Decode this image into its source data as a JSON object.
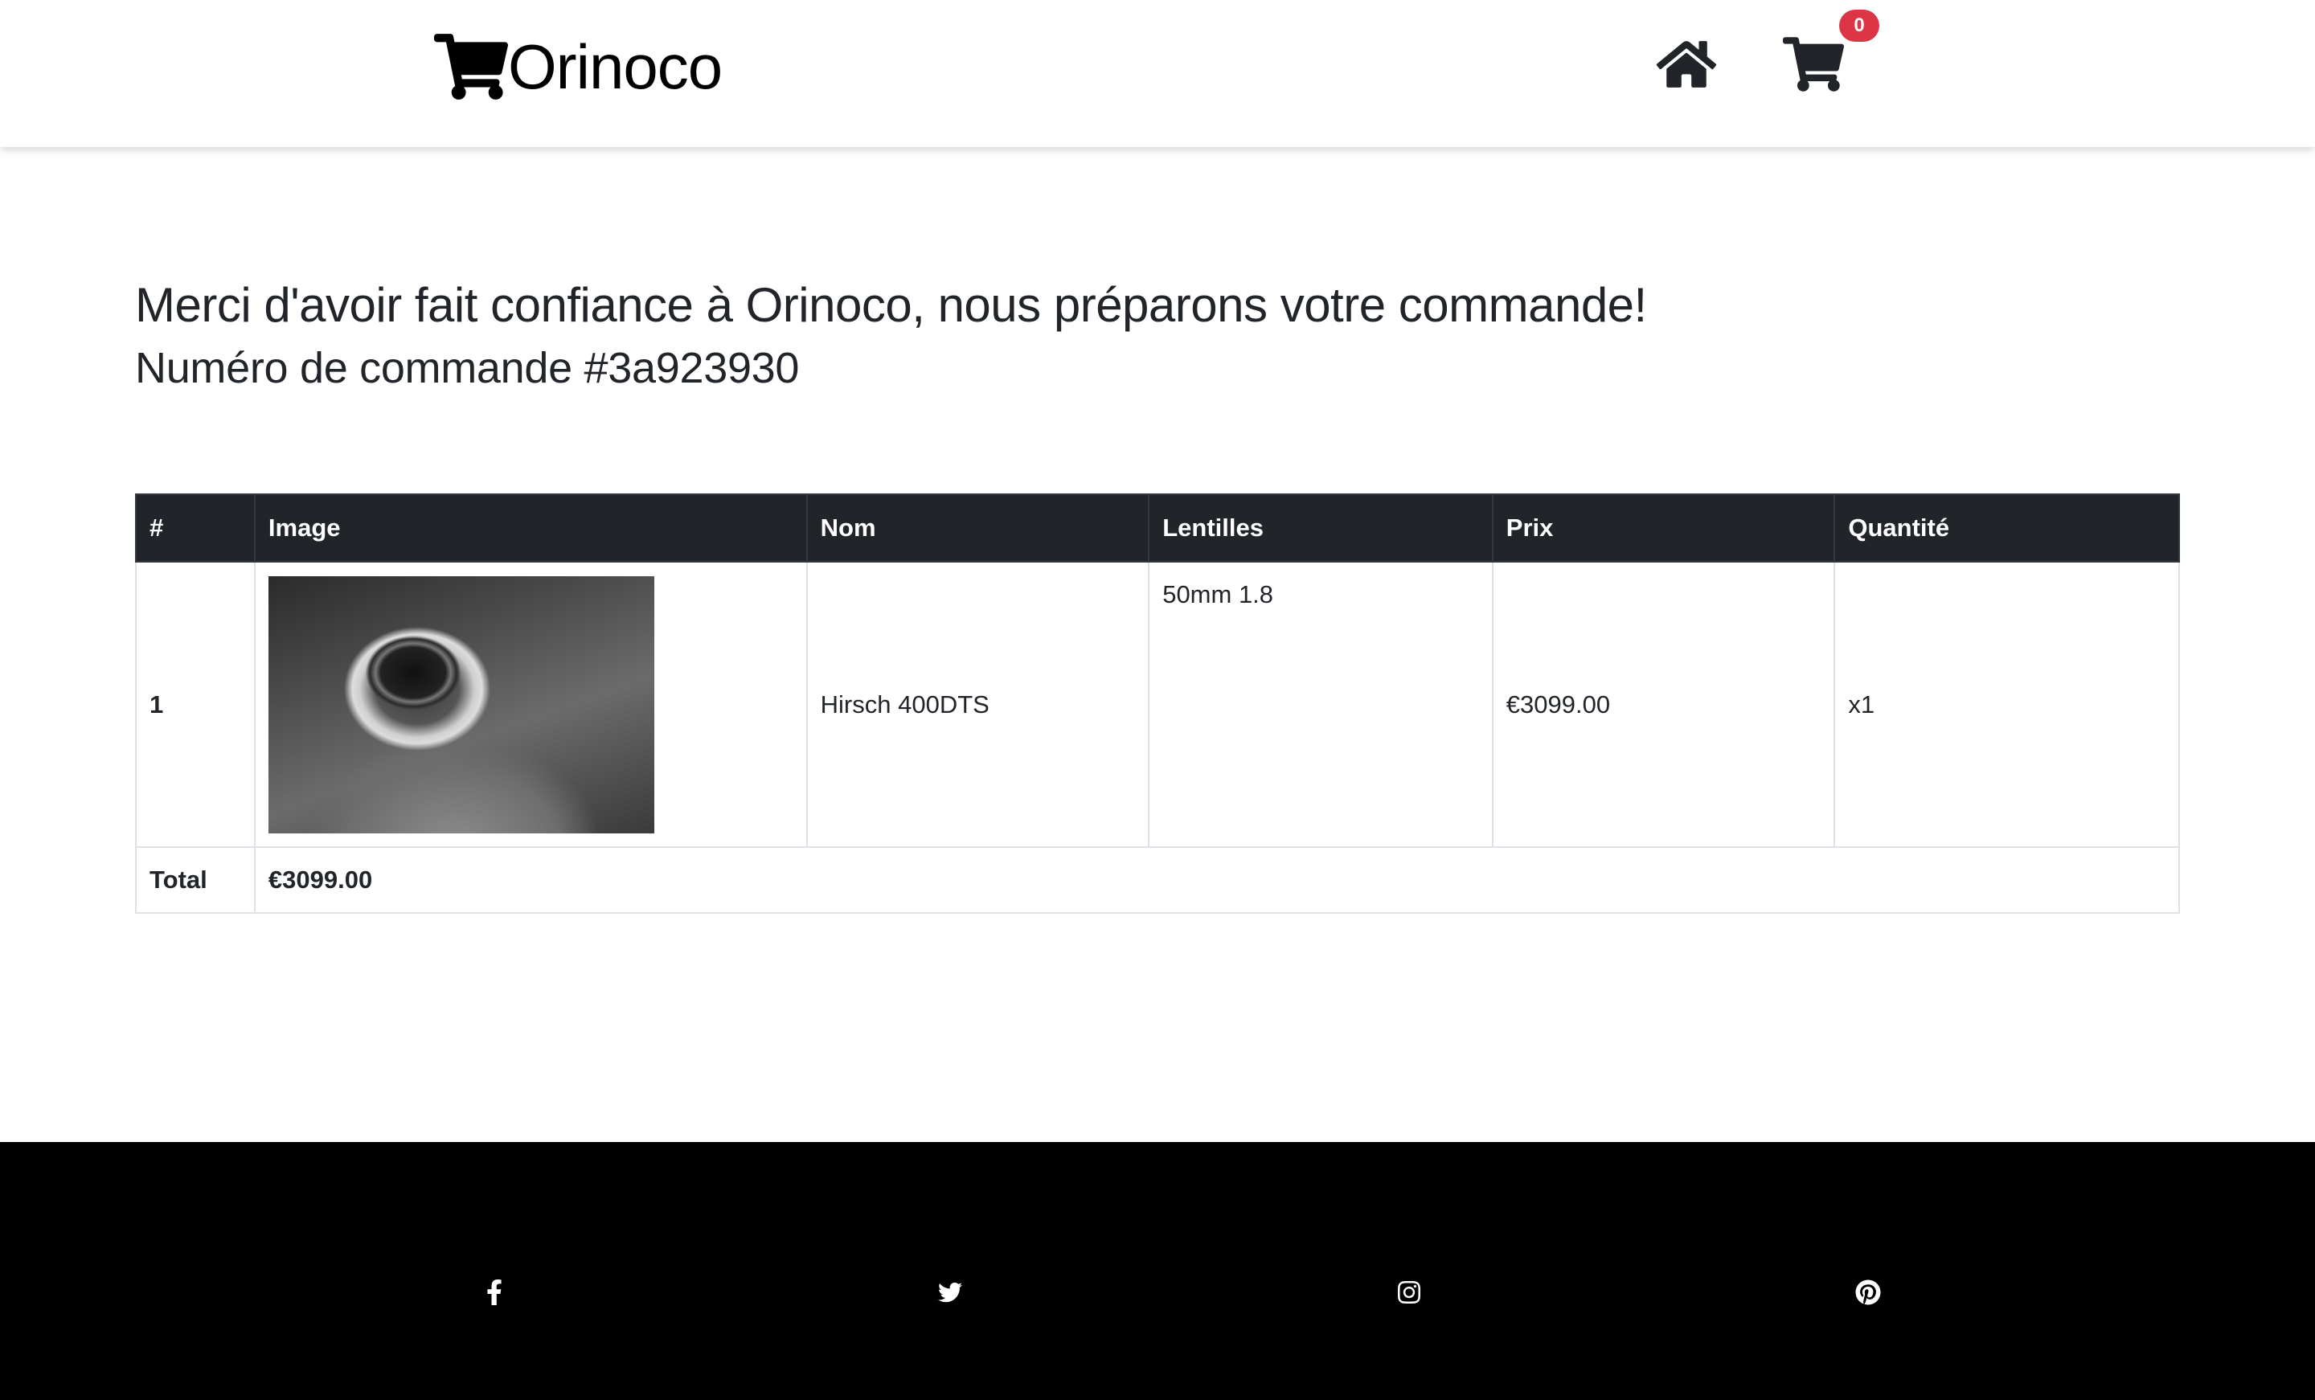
{
  "navbar": {
    "brand": "Orinoco",
    "cart_count": "0",
    "icons": {
      "brand": "shopping-cart-icon",
      "home": "home-icon",
      "cart": "shopping-cart-icon"
    }
  },
  "confirmation": {
    "message": "Merci d'avoir fait confiance à Orinoco, nous préparons votre commande!",
    "order_number": "Numéro de commande #3a923930"
  },
  "table": {
    "headers": [
      "#",
      "Image",
      "Nom",
      "Lentilles",
      "Prix",
      "Quantité"
    ],
    "rows": [
      {
        "index": "1",
        "image": "camera-photo",
        "name": "Hirsch 400DTS",
        "lenses": "50mm 1.8",
        "price": "€3099.00",
        "quantity": "x1"
      }
    ],
    "total_label": "Total",
    "total_value": "€3099.00"
  },
  "footer": {
    "social": [
      "facebook-icon",
      "twitter-icon",
      "instagram-icon",
      "pinterest-icon"
    ]
  },
  "colors": {
    "table_header_bg": "#212529",
    "badge": "#dc3545",
    "footer_bg": "#000000"
  }
}
